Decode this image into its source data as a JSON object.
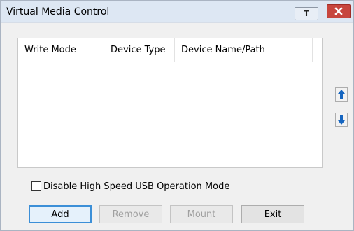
{
  "window": {
    "title": "Virtual Media Control",
    "pin_label": "T"
  },
  "listview": {
    "columns": [
      "Write Mode",
      "Device Type",
      "Device Name/Path"
    ],
    "rows": []
  },
  "options": {
    "disable_high_speed_usb": {
      "label": "Disable High Speed USB Operation Mode",
      "checked": false
    }
  },
  "buttons": {
    "add": "Add",
    "remove": "Remove",
    "mount": "Mount",
    "exit": "Exit"
  },
  "icons": {
    "close": "close-icon",
    "move_up": "arrow-up-icon",
    "move_down": "arrow-down-icon"
  },
  "colors": {
    "titlebar": "#dde7f3",
    "close_button": "#c7463e",
    "arrow_blue": "#1565c0",
    "focus_border": "#3c8fd7"
  }
}
